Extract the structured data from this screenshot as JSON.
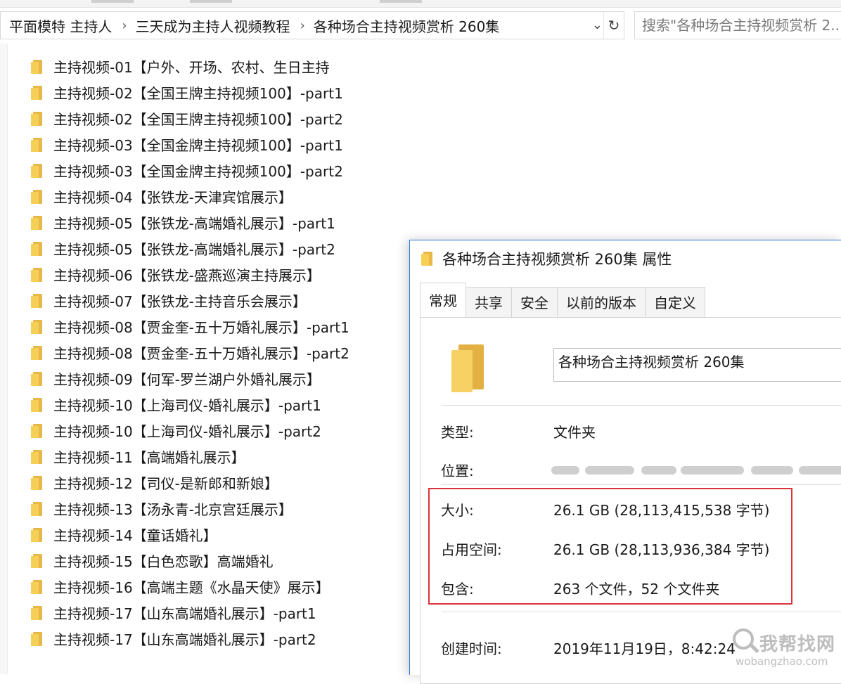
{
  "explorer": {
    "breadcrumb": [
      "平面模特 主持人",
      "三天成为主持人视频教程",
      "各种场合主持视频赏析 260集"
    ],
    "breadcrumb_separator": "›",
    "dropdown_glyph": "⌄",
    "refresh_glyph": "↻",
    "search_placeholder": "搜索\"各种场合主持视频赏析 2...",
    "folders": [
      "主持视频-01【户外、开场、农村、生日主持",
      "主持视频-02【全国王牌主持视频100】-part1",
      "主持视频-02【全国王牌主持视频100】-part2",
      "主持视频-03【全国金牌主持视频100】-part1",
      "主持视频-03【全国金牌主持视频100】-part2",
      "主持视频-04【张铁龙-天津宾馆展示】",
      "主持视频-05【张铁龙-高端婚礼展示】-part1",
      "主持视频-05【张铁龙-高端婚礼展示】-part2",
      "主持视频-06【张铁龙-盛燕巡演主持展示】",
      "主持视频-07【张铁龙-主持音乐会展示】",
      "主持视频-08【贾金奎-五十万婚礼展示】-part1",
      "主持视频-08【贾金奎-五十万婚礼展示】-part2",
      "主持视频-09【何军-罗兰湖户外婚礼展示】",
      "主持视频-10【上海司仪-婚礼展示】-part1",
      "主持视频-10【上海司仪-婚礼展示】-part2",
      "主持视频-11【高端婚礼展示】",
      "主持视频-12【司仪-是新郎和新娘】",
      "主持视频-13【汤永青-北京宫廷展示】",
      "主持视频-14【童话婚礼】",
      "主持视频-15【白色恋歌】高端婚礼",
      "主持视频-16【高端主题《水晶天使》展示】",
      "主持视频-17【山东高端婚礼展示】-part1",
      "主持视频-17【山东高端婚礼展示】-part2"
    ],
    "folder_icon": "folder-icon"
  },
  "dialog": {
    "title": "各种场合主持视频赏析 260集 属性",
    "tabs": [
      "常规",
      "共享",
      "安全",
      "以前的版本",
      "自定义"
    ],
    "active_tab": 0,
    "name_value": "各种场合主持视频赏析 260集",
    "props": {
      "type_label": "类型:",
      "type_value": "文件夹",
      "location_label": "位置:",
      "size_label": "大小:",
      "size_value": "26.1 GB (28,113,415,538 字节)",
      "disk_label": "占用空间:",
      "disk_value": "26.1 GB (28,113,936,384 字节)",
      "contains_label": "包含:",
      "contains_value": "263 个文件，52 个文件夹",
      "created_label": "创建时间:",
      "created_value": "2019年11月19日，8:42:24"
    },
    "highlight_color": "#d9343a"
  },
  "watermark": {
    "title": "我帮找网",
    "url": "wobangzhao.com"
  },
  "colors": {
    "folder_front": "#f6cf57",
    "folder_back": "#e8b84a",
    "dialog_border": "#2b79d6"
  }
}
